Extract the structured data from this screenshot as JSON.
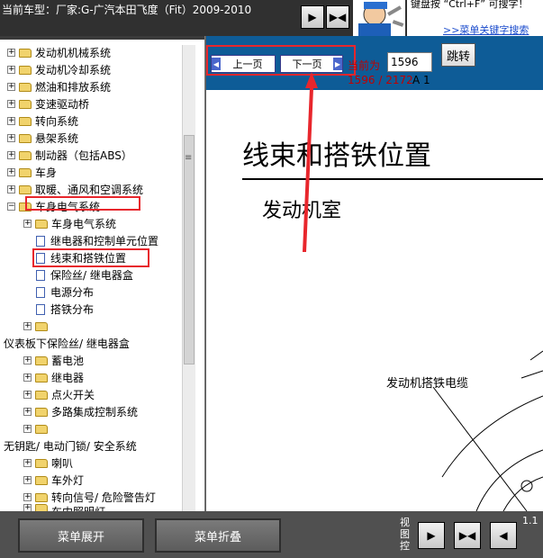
{
  "header": {
    "car_title": "当前车型：厂家:G-广汽本田飞度（Fit）2009-2010",
    "btn_a_icon": "▶",
    "btn_b_icon": "▶◀",
    "search_hint": "键盘按 “Ctrl+F” 可搜字！",
    "search_link": ">>菜单关键字搜索"
  },
  "sidebar": {
    "items": [
      {
        "label": "发动机机械系统"
      },
      {
        "label": "发动机冷却系统"
      },
      {
        "label": "燃油和排放系统"
      },
      {
        "label": "变速驱动桥"
      },
      {
        "label": "转向系统"
      },
      {
        "label": "悬架系统"
      },
      {
        "label": "制动器（包括ABS）"
      },
      {
        "label": "车身"
      },
      {
        "label": "取暖、通风和空调系统"
      },
      {
        "label": "车身电气系统"
      },
      {
        "label": "车身电气系统"
      },
      {
        "label": "继电器和控制单元位置"
      },
      {
        "label": "线束和搭铁位置"
      },
      {
        "label": "保险丝/ 继电器盒"
      },
      {
        "label": "电源分布"
      },
      {
        "label": "搭铁分布"
      },
      {
        "label": ""
      },
      {
        "label": "仪表板下保险丝/ 继电器盒"
      },
      {
        "label": "蓄电池"
      },
      {
        "label": "继电器"
      },
      {
        "label": "点火开关"
      },
      {
        "label": "多路集成控制系统"
      },
      {
        "label": ""
      },
      {
        "label": "无钥匙/ 电动门锁/ 安全系统"
      },
      {
        "label": "喇叭"
      },
      {
        "label": "车外灯"
      },
      {
        "label": "转向信号/ 危险警告灯"
      },
      {
        "label": "车内照明灯"
      }
    ]
  },
  "viewer": {
    "prev_label": "上一页",
    "next_label": "下一页",
    "page_label": "当前为",
    "page_value": "1596",
    "jump_label": "跳转",
    "page_count": "1596 / 2172",
    "page_ab": "A 1"
  },
  "doc": {
    "title": "线束和搭铁位置",
    "subtitle": "发动机室",
    "label": "发动机搭铁电缆"
  },
  "footer": {
    "expand_label": "菜单展开",
    "collapse_label": "菜单折叠",
    "view_label": "视图控",
    "zoom_label": "1.1"
  },
  "colors": {
    "annotation": "#e8262c",
    "viewer_bar": "#0e5c97",
    "page_text": "#c00000"
  }
}
